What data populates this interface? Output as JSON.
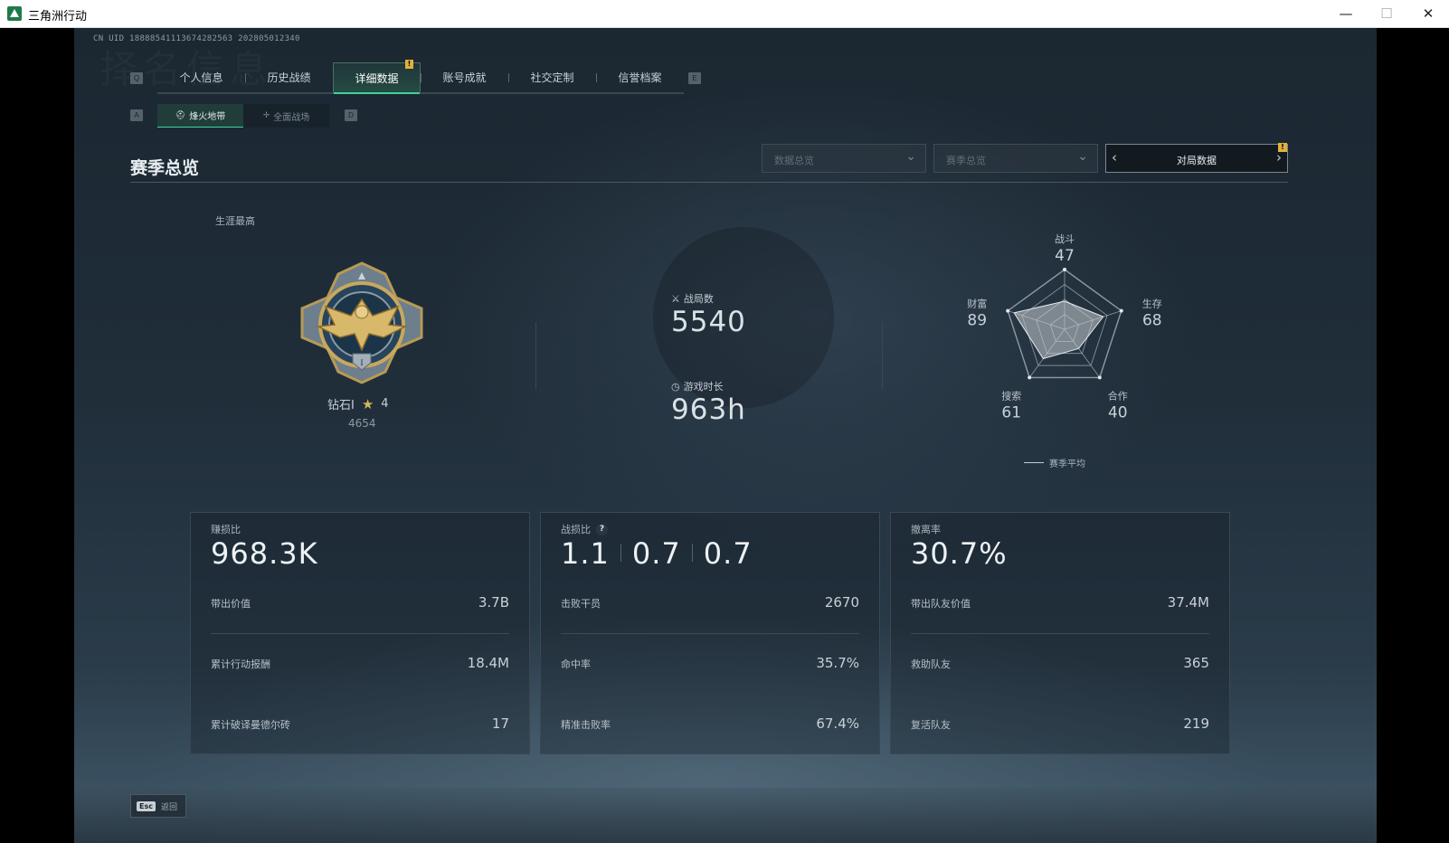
{
  "window": {
    "title": "三角洲行动",
    "minimize": "—",
    "maximize": "☐",
    "close": "✕"
  },
  "uid": "CN UID 18888541113674282563 202805012340",
  "bg_title": "择名信息",
  "tabs": {
    "left_key": "Q",
    "right_key": "E",
    "items": [
      {
        "label": "个人信息"
      },
      {
        "label": "历史战绩"
      },
      {
        "label": "详细数据"
      },
      {
        "label": "账号成就"
      },
      {
        "label": "社交定制"
      },
      {
        "label": "信誉档案"
      }
    ],
    "badge": "!"
  },
  "subtabs": {
    "left_key": "A",
    "right_key": "D",
    "items": [
      {
        "label": "烽火地带",
        "icon": "helmet-icon"
      },
      {
        "label": "全面战场",
        "icon": "crosshair-icon"
      }
    ]
  },
  "section": {
    "title": "赛季总览",
    "dropdown1": "数据总览",
    "dropdown2": "赛季总览",
    "nav_label": "对局数据",
    "nav_badge": "!"
  },
  "career": {
    "label": "生涯最高",
    "rank": "钻石I",
    "stars": "4",
    "score": "4654"
  },
  "overview": {
    "matches_label": "战局数",
    "matches": "5540",
    "playtime_label": "游戏时长",
    "playtime": "963h"
  },
  "radar": {
    "max": 100,
    "axes": [
      {
        "name": "战斗",
        "value": 47
      },
      {
        "name": "生存",
        "value": 68
      },
      {
        "name": "合作",
        "value": 40
      },
      {
        "name": "搜索",
        "value": 61
      },
      {
        "name": "财富",
        "value": 89
      }
    ],
    "legend": "赛季平均"
  },
  "cards": [
    {
      "head": "赚损比",
      "big": "968.3K",
      "rows": [
        {
          "label": "带出价值",
          "value": "3.7B"
        },
        {
          "label": "累计行动报酬",
          "value": "18.4M"
        },
        {
          "label": "累计破译曼德尔砖",
          "value": "17"
        }
      ]
    },
    {
      "head": "战损比",
      "help": "?",
      "big_parts": [
        "1.1",
        "0.7",
        "0.7"
      ],
      "rows": [
        {
          "label": "击败干员",
          "value": "2670"
        },
        {
          "label": "命中率",
          "value": "35.7%"
        },
        {
          "label": "精准击败率",
          "value": "67.4%"
        }
      ]
    },
    {
      "head": "撤离率",
      "big": "30.7%",
      "rows": [
        {
          "label": "带出队友价值",
          "value": "37.4M"
        },
        {
          "label": "救助队友",
          "value": "365"
        },
        {
          "label": "复活队友",
          "value": "219"
        }
      ]
    }
  ],
  "footer": {
    "esc_key": "Esc",
    "back_label": "返回"
  }
}
